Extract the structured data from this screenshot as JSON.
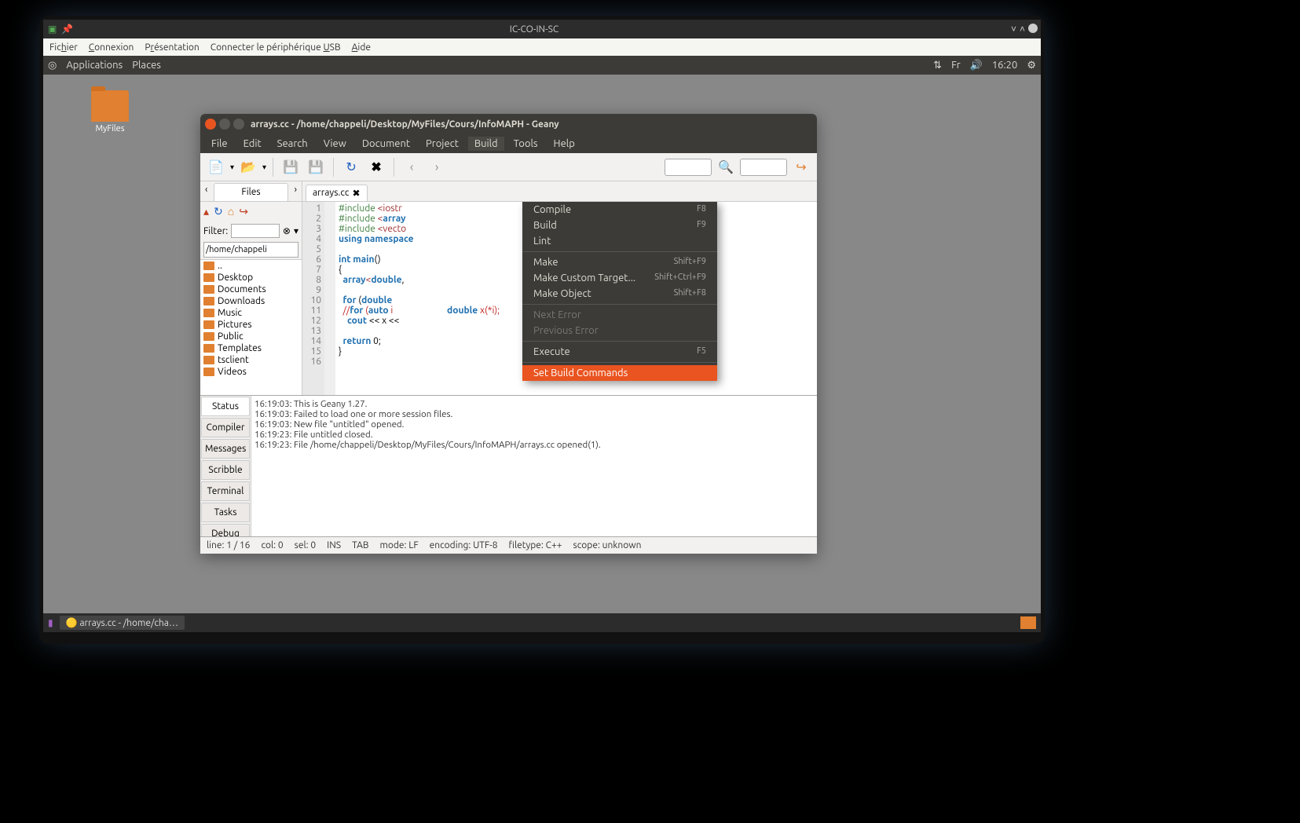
{
  "vm": {
    "title": "IC-CO-IN-SC",
    "menu": [
      "Fic<u>h</u>ier",
      "<u>C</u>onnexion",
      "P<u>r</u>ésentation",
      "Connecter le périphérique <u>U</u>SB",
      "<u>A</u>ide"
    ]
  },
  "panel": {
    "left": [
      "Applications",
      "Places"
    ],
    "right": {
      "net": "⇅",
      "lang": "Fr",
      "sound": "🔊",
      "time": "16:20",
      "cog": "⚙"
    }
  },
  "desktop_icon": "MyFiles",
  "geany": {
    "title": "arrays.cc - /home/chappeli/Desktop/MyFiles/Cours/InfoMAPH - Geany",
    "menu": [
      "File",
      "Edit",
      "Search",
      "View",
      "Document",
      "Project",
      "Build",
      "Tools",
      "Help"
    ],
    "active_menu": "Build",
    "sidebar": {
      "tab": "Files",
      "filter_label": "Filter:",
      "path": "/home/chappeli",
      "items": [
        "..",
        "Desktop",
        "Documents",
        "Downloads",
        "Music",
        "Pictures",
        "Public",
        "Templates",
        "tsclient",
        "Videos"
      ]
    },
    "file_tab": "arrays.cc",
    "code_lines": [
      "#include <iostr",
      "#include <array",
      "#include <vecto",
      "using namespace",
      "",
      "int main()",
      "{",
      "  array<double,",
      "",
      "  for (double ",
      "  //for (auto i                         double x(*i);",
      "    cout << x <<",
      "",
      "  return 0;",
      "}",
      ""
    ],
    "build_menu": [
      {
        "label": "Compile",
        "key": "F8"
      },
      {
        "label": "Build",
        "key": "F9"
      },
      {
        "label": "Lint",
        "key": ""
      },
      {
        "sep": true
      },
      {
        "label": "Make",
        "key": "Shift+F9"
      },
      {
        "label": "Make Custom Target...",
        "key": "Shift+Ctrl+F9"
      },
      {
        "label": "Make Object",
        "key": "Shift+F8"
      },
      {
        "sep": true
      },
      {
        "label": "Next Error",
        "key": "",
        "disabled": true
      },
      {
        "label": "Previous Error",
        "key": "",
        "disabled": true
      },
      {
        "sep": true
      },
      {
        "label": "Execute",
        "key": "F5"
      },
      {
        "sep": true
      },
      {
        "label": "Set Build Commands",
        "key": "",
        "hl": true
      }
    ],
    "msg_tabs": [
      "Status",
      "Compiler",
      "Messages",
      "Scribble",
      "Terminal",
      "Tasks",
      "Debug"
    ],
    "msg_active": "Status",
    "messages": [
      "16:19:03: This is Geany 1.27.",
      "16:19:03: Failed to load one or more session files.",
      "16:19:03: New file \"untitled\" opened.",
      "16:19:23: File untitled closed.",
      "16:19:23: File /home/chappeli/Desktop/MyFiles/Cours/InfoMAPH/arrays.cc opened(1)."
    ],
    "status": {
      "line": "line: 1 / 16",
      "col": "col: 0",
      "sel": "sel: 0",
      "ins": "INS",
      "tab": "TAB",
      "mode": "mode: LF",
      "enc": "encoding: UTF-8",
      "ft": "filetype: C++",
      "scope": "scope: unknown"
    }
  },
  "taskbar_item": "arrays.cc - /home/cha…"
}
